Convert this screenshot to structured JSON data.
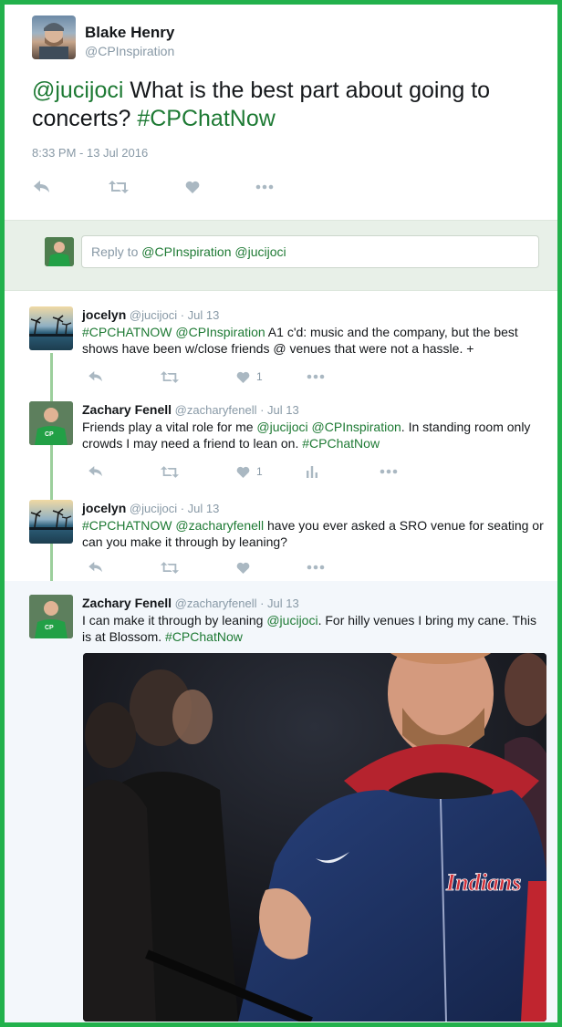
{
  "main_tweet": {
    "name": "Blake Henry",
    "handle": "@CPInspiration",
    "mention": "@jucijoci",
    "text": " What is the best part about going to concerts? ",
    "hashtag": "#CPChatNow",
    "timestamp": "8:33 PM - 13 Jul 2016",
    "actions": [
      "reply-icon",
      "retweet-icon",
      "like-icon",
      "more-icon"
    ]
  },
  "reply_box": {
    "prefix": "Reply to ",
    "mentions": "@CPInspiration @jucijoci"
  },
  "replies": [
    {
      "name": "jocelyn",
      "handle": "@jucijoci",
      "date": "· Jul 13",
      "parts": [
        "#CPCHATNOW",
        " ",
        "@CPInspiration",
        " A1 c'd: music and the company, but the best shows have been w/close friends @ venues that were not a hassle. +"
      ],
      "likes": "1"
    },
    {
      "name": "Zachary Fenell",
      "handle": "@zacharyfenell",
      "date": "· Jul 13",
      "parts": [
        "Friends play a vital role for me ",
        "@jucijoci",
        " ",
        "@CPInspiration",
        ". In standing room only crowds I may need a friend to lean on. ",
        "#CPChatNow"
      ],
      "likes": "1"
    },
    {
      "name": "jocelyn",
      "handle": "@jucijoci",
      "date": "· Jul 13",
      "parts": [
        "#CPCHATNOW",
        " ",
        "@zacharyfenell",
        " have you ever asked a SRO venue for seating or can you make it through by leaning?"
      ],
      "likes": ""
    },
    {
      "name": "Zachary Fenell",
      "handle": "@zacharyfenell",
      "date": "· Jul 13",
      "parts": [
        "I can make it through by leaning ",
        "@jucijoci",
        ". For hilly venues I bring my cane. This is at Blossom. ",
        "#CPChatNow"
      ],
      "photo_logo": "Indians"
    }
  ],
  "colors": {
    "frame": "#22b14c",
    "link": "#1e7a34",
    "muted": "#8899a6",
    "thread_line": "#9ccf9c"
  }
}
